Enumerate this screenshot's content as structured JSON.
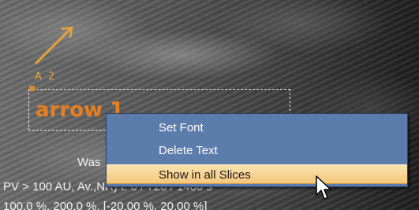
{
  "annotation": {
    "arrow_tag": "A 2",
    "text_label": "arrow 1"
  },
  "overlay": {
    "line1": "Was",
    "line2": "PV > 100 AU, Av.,NR) t: 0 / 720 / 1400 s",
    "line3": "100.0 %, 200.0 %, [-20.00 %, 20.00 %]"
  },
  "context_menu": {
    "items": [
      {
        "label": "Set Font"
      },
      {
        "label": "Delete Text"
      },
      {
        "label": "Show in all Slices",
        "highlighted": true
      }
    ]
  },
  "colors": {
    "annotation_orange": "#e67f22",
    "menu_blue": "#5c7cac",
    "menu_highlight": "#f3c67a"
  }
}
